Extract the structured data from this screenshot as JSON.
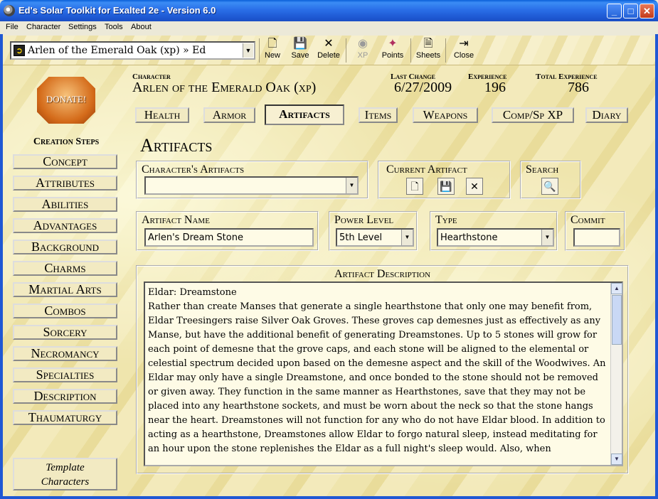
{
  "window": {
    "title": "Ed's Solar Toolkit for Exalted 2e - Version 6.0",
    "minimize": "_",
    "maximize": "□",
    "close": "✕"
  },
  "menu": [
    "File",
    "Character",
    "Settings",
    "Tools",
    "About"
  ],
  "toolbar": {
    "character_selected": "Arlen of the Emerald Oak (xp) » Ed",
    "buttons": [
      {
        "label": "New",
        "icon": "new-file-icon",
        "glyph": "🗋",
        "enabled": true
      },
      {
        "label": "Save",
        "icon": "floppy-disk-icon",
        "glyph": "💾",
        "enabled": true
      },
      {
        "label": "Delete",
        "icon": "x-icon",
        "glyph": "✕",
        "enabled": true
      },
      {
        "label": "XP",
        "icon": "xp-icon",
        "glyph": "◉",
        "enabled": false
      },
      {
        "label": "Points",
        "icon": "points-icon",
        "glyph": "✦",
        "enabled": true
      },
      {
        "label": "Sheets",
        "icon": "sheets-icon",
        "glyph": "🗎",
        "enabled": true
      },
      {
        "label": "Close",
        "icon": "door-icon",
        "glyph": "⇥",
        "enabled": true
      }
    ]
  },
  "donate_label": "DONATE!",
  "creation_steps": {
    "title": "Creation Steps",
    "items": [
      "Concept",
      "Attributes",
      "Abilities",
      "Advantages",
      "Background",
      "Charms",
      "Martial Arts",
      "Combos",
      "Sorcery",
      "Necromancy",
      "Specialties",
      "Description",
      "Thaumaturgy"
    ]
  },
  "template_button": "Template\nCharacters",
  "header": {
    "character_label": "Character",
    "character_name": "Arlen of the Emerald Oak (xp)",
    "last_change_label": "Last Change",
    "last_change": "6/27/2009",
    "experience_label": "Experience",
    "experience": "196",
    "total_experience_label": "Total Experience",
    "total_experience": "786"
  },
  "tabs": [
    {
      "label": "Health",
      "active": false
    },
    {
      "label": "Armor",
      "active": false
    },
    {
      "label": "Artifacts",
      "active": true
    },
    {
      "label": "Items",
      "active": false
    },
    {
      "label": "Weapons",
      "active": false
    },
    {
      "label": "Comp/Sp XP",
      "active": false
    },
    {
      "label": "Diary",
      "active": false
    }
  ],
  "section_title": "Artifacts",
  "characters_artifacts": {
    "label": "Character's Artifacts",
    "value": ""
  },
  "current_artifact": {
    "label": "Current Artifact"
  },
  "search": {
    "label": "Search"
  },
  "artifact_name": {
    "label": "Artifact Name",
    "value": "Arlen's Dream Stone"
  },
  "power_level": {
    "label": "Power Level",
    "value": "5th Level"
  },
  "type": {
    "label": "Type",
    "value": "Hearthstone"
  },
  "commit": {
    "label": "Commit",
    "value": ""
  },
  "description": {
    "label": "Artifact Description",
    "text": "Eldar: Dreamstone\nRather than create Manses that generate a single hearthstone that only one may benefit from, Eldar Treesingers raise Silver Oak Groves. These groves cap demesnes just as effectively as any Manse, but have the additional benefit of generating Dreamstones. Up to 5 stones will grow for each point of demesne that the grove caps, and each stone will be aligned to the elemental or celestial spectrum decided upon based on the demesne aspect and the skill of the Woodwives. An Eldar may only have a single Dreamstone, and once bonded to the stone should not be removed or given away. They function in the same manner as Hearthstones, save that they may not be placed into any hearthstone sockets, and must be worn about the neck so that the stone hangs near the heart. Dreamstones will not function for any who do not have Eldar blood. In addition to acting as a hearthstone, Dreamstones allow Eldar to forgo natural sleep, instead meditating for an hour upon the stone replenishes the Eldar as a full night's sleep would. Also, when"
  }
}
